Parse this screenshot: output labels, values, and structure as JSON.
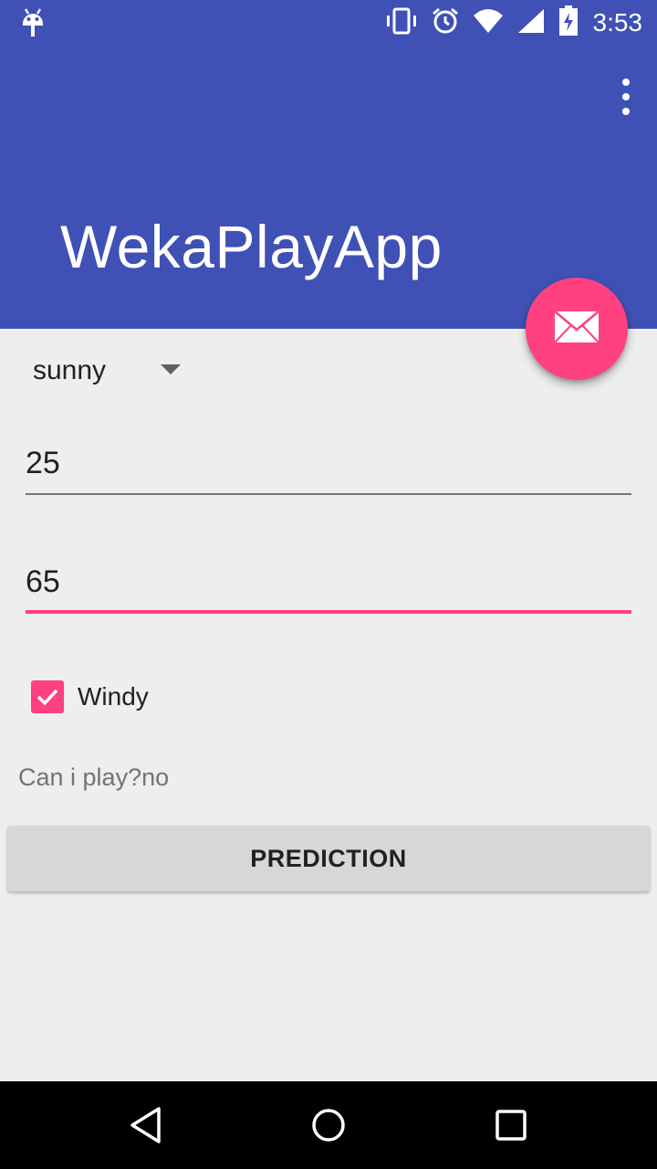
{
  "status_bar": {
    "time": "3:53",
    "icons": [
      "android-debug-icon",
      "vibrate-icon",
      "alarm-icon",
      "wifi-icon",
      "signal-icon",
      "battery-charging-icon"
    ]
  },
  "app_bar": {
    "title": "WekaPlayApp",
    "color": "#3f51b5",
    "overflow_icon": "more-vert-icon"
  },
  "fab": {
    "icon": "email-icon",
    "color": "#ff4081"
  },
  "form": {
    "outlook_selected": "sunny",
    "temperature_value": "25",
    "humidity_value": "65",
    "windy_checked": true,
    "windy_label": "Windy",
    "result_text": "Can i play?no",
    "predict_button_label": "PREDICTION",
    "accent_color": "#ff4081"
  },
  "nav_bar": {
    "icons": [
      "back-icon",
      "home-icon",
      "recents-icon"
    ]
  }
}
